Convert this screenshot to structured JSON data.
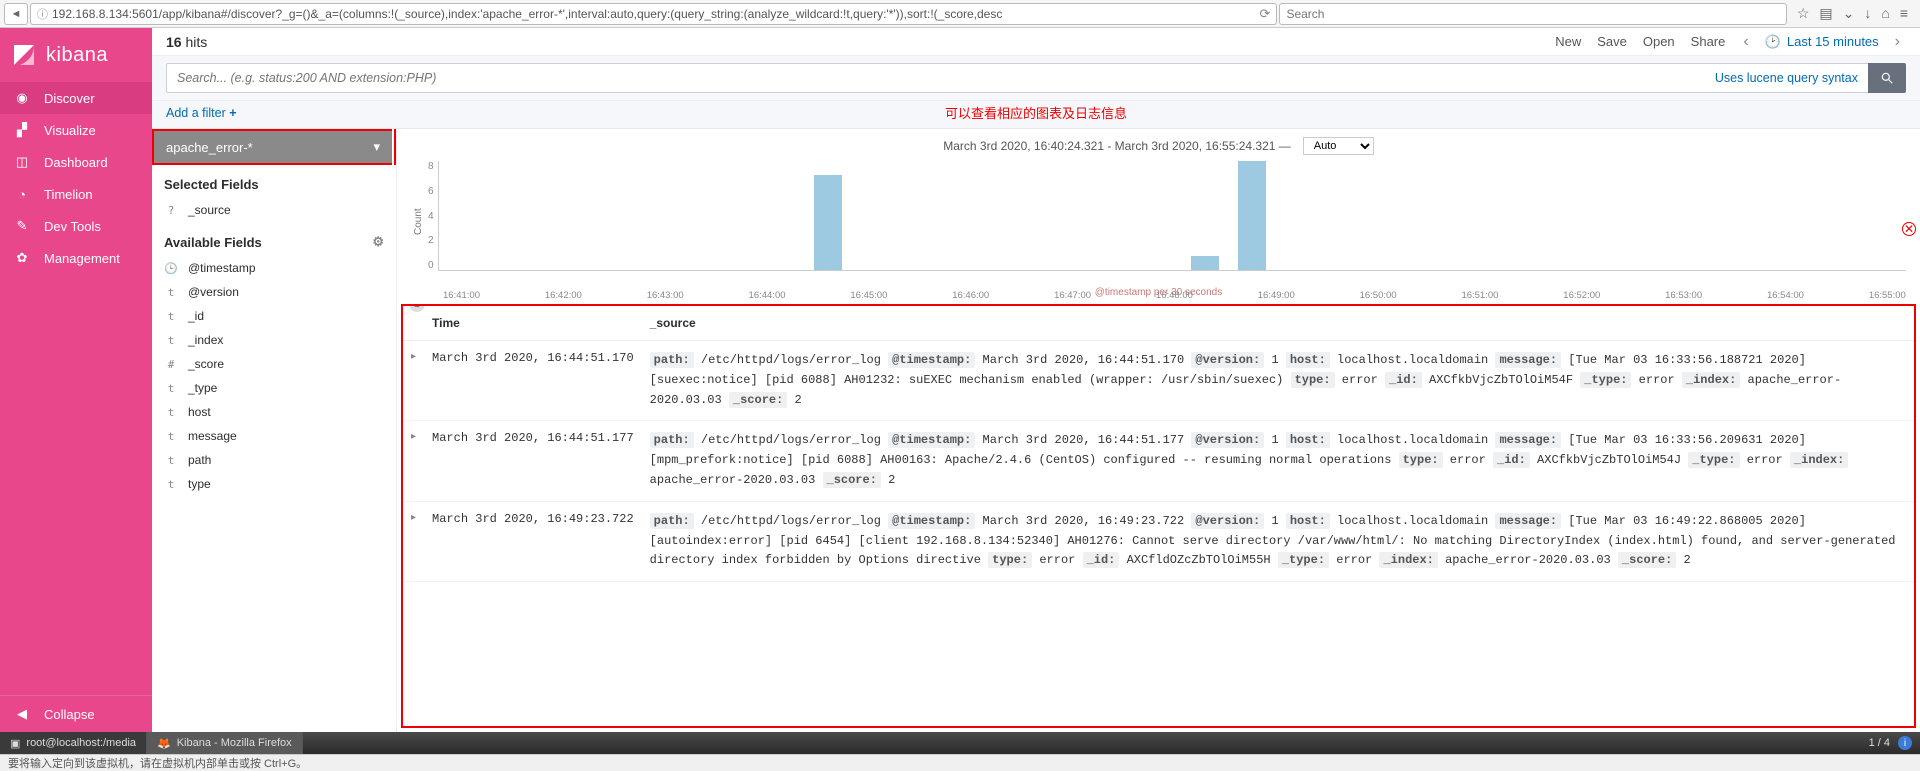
{
  "browser": {
    "url": "192.168.8.134:5601/app/kibana#/discover?_g=()&_a=(columns:!(_source),index:'apache_error-*',interval:auto,query:(query_string:(analyze_wildcard:!t,query:'*')),sort:!(_score,desc",
    "url_prefix": "",
    "search_placeholder": "Search",
    "icons": [
      "star-icon",
      "clipboard-icon",
      "pocket-icon",
      "download-icon",
      "home-icon",
      "menu-icon"
    ]
  },
  "sidebar": {
    "brand": "kibana",
    "items": [
      {
        "icon": "compass-icon",
        "label": "Discover",
        "active": true
      },
      {
        "icon": "bar-chart-icon",
        "label": "Visualize",
        "active": false
      },
      {
        "icon": "dashboard-icon",
        "label": "Dashboard",
        "active": false
      },
      {
        "icon": "clock-icon",
        "label": "Timelion",
        "active": false
      },
      {
        "icon": "wrench-icon",
        "label": "Dev Tools",
        "active": false
      },
      {
        "icon": "gear-icon",
        "label": "Management",
        "active": false
      }
    ],
    "collapse": "Collapse"
  },
  "topbar": {
    "hits_count": "16",
    "hits_label": "hits",
    "actions": [
      "New",
      "Save",
      "Open",
      "Share"
    ],
    "time_label": "Last 15 minutes"
  },
  "search": {
    "placeholder": "Search... (e.g. status:200 AND extension:PHP)",
    "syntax_hint": "Uses lucene query syntax"
  },
  "filters": {
    "add_label": "Add a filter",
    "annotation_cn": "可以查看相应的图表及日志信息"
  },
  "fields": {
    "index_pattern": "apache_error-*",
    "selected_title": "Selected Fields",
    "selected": [
      {
        "type": "?",
        "name": "_source"
      }
    ],
    "available_title": "Available Fields",
    "available": [
      {
        "type": "🕒",
        "name": "@timestamp"
      },
      {
        "type": "t",
        "name": "@version"
      },
      {
        "type": "t",
        "name": "_id"
      },
      {
        "type": "t",
        "name": "_index"
      },
      {
        "type": "#",
        "name": "_score"
      },
      {
        "type": "t",
        "name": "_type"
      },
      {
        "type": "t",
        "name": "host"
      },
      {
        "type": "t",
        "name": "message"
      },
      {
        "type": "t",
        "name": "path"
      },
      {
        "type": "t",
        "name": "type"
      }
    ]
  },
  "chart_data": {
    "type": "bar",
    "title": "March 3rd 2020, 16:40:24.321 - March 3rd 2020, 16:55:24.321 —",
    "interval_select": "Auto",
    "ylabel": "Count",
    "xlabel": "@timestamp per 30 seconds",
    "ylim": [
      0,
      8
    ],
    "y_ticks": [
      8,
      6,
      4,
      2,
      0
    ],
    "x_ticks": [
      "16:41:00",
      "16:42:00",
      "16:43:00",
      "16:44:00",
      "16:45:00",
      "16:46:00",
      "16:47:00",
      "16:48:00",
      "16:49:00",
      "16:50:00",
      "16:51:00",
      "16:52:00",
      "16:53:00",
      "16:54:00",
      "16:55:00"
    ],
    "bars": [
      {
        "x_frac": 0.256,
        "value": 7
      },
      {
        "x_frac": 0.513,
        "value": 1
      },
      {
        "x_frac": 0.545,
        "value": 8
      }
    ]
  },
  "docs": {
    "col_time": "Time",
    "col_source": "_source",
    "rows": [
      {
        "time": "March 3rd 2020, 16:44:51.170",
        "fields": {
          "path": "/etc/httpd/logs/error_log",
          "@timestamp": "March 3rd 2020, 16:44:51.170",
          "@version": "1",
          "host": "localhost.localdomain",
          "message": "[Tue Mar 03 16:33:56.188721 2020] [suexec:notice] [pid 6088] AH01232: suEXEC mechanism enabled (wrapper: /usr/sbin/suexec)",
          "type": "error",
          "_id": "AXCfkbVjcZbTOlOiM54F",
          "_type": "error",
          "_index": "apache_error-2020.03.03",
          "_score": "2"
        }
      },
      {
        "time": "March 3rd 2020, 16:44:51.177",
        "fields": {
          "path": "/etc/httpd/logs/error_log",
          "@timestamp": "March 3rd 2020, 16:44:51.177",
          "@version": "1",
          "host": "localhost.localdomain",
          "message": "[Tue Mar 03 16:33:56.209631 2020] [mpm_prefork:notice] [pid 6088] AH00163: Apache/2.4.6 (CentOS) configured -- resuming normal operations",
          "type": "error",
          "_id": "AXCfkbVjcZbTOlOiM54J",
          "_type": "error",
          "_index": "apache_error-2020.03.03",
          "_score": "2"
        }
      },
      {
        "time": "March 3rd 2020, 16:49:23.722",
        "fields": {
          "path": "/etc/httpd/logs/error_log",
          "@timestamp": "March 3rd 2020, 16:49:23.722",
          "@version": "1",
          "host": "localhost.localdomain",
          "message": "[Tue Mar 03 16:49:22.868005 2020] [autoindex:error] [pid 6454] [client 192.168.8.134:52340] AH01276: Cannot serve directory /var/www/html/: No matching DirectoryIndex (index.html) found, and server-generated directory index forbidden by Options directive",
          "type": "error",
          "_id": "AXCfldOZcZbTOlOiM55H",
          "_type": "error",
          "_index": "apache_error-2020.03.03",
          "_score": "2"
        }
      }
    ]
  },
  "taskbar": {
    "items": [
      {
        "icon": "terminal-icon",
        "label": "root@localhost:/media"
      },
      {
        "icon": "firefox-icon",
        "label": "Kibana - Mozilla Firefox"
      }
    ],
    "right": "1 / 4"
  },
  "status_bar": "要将输入定向到该虚拟机，请在虚拟机内部单击或按 Ctrl+G。"
}
